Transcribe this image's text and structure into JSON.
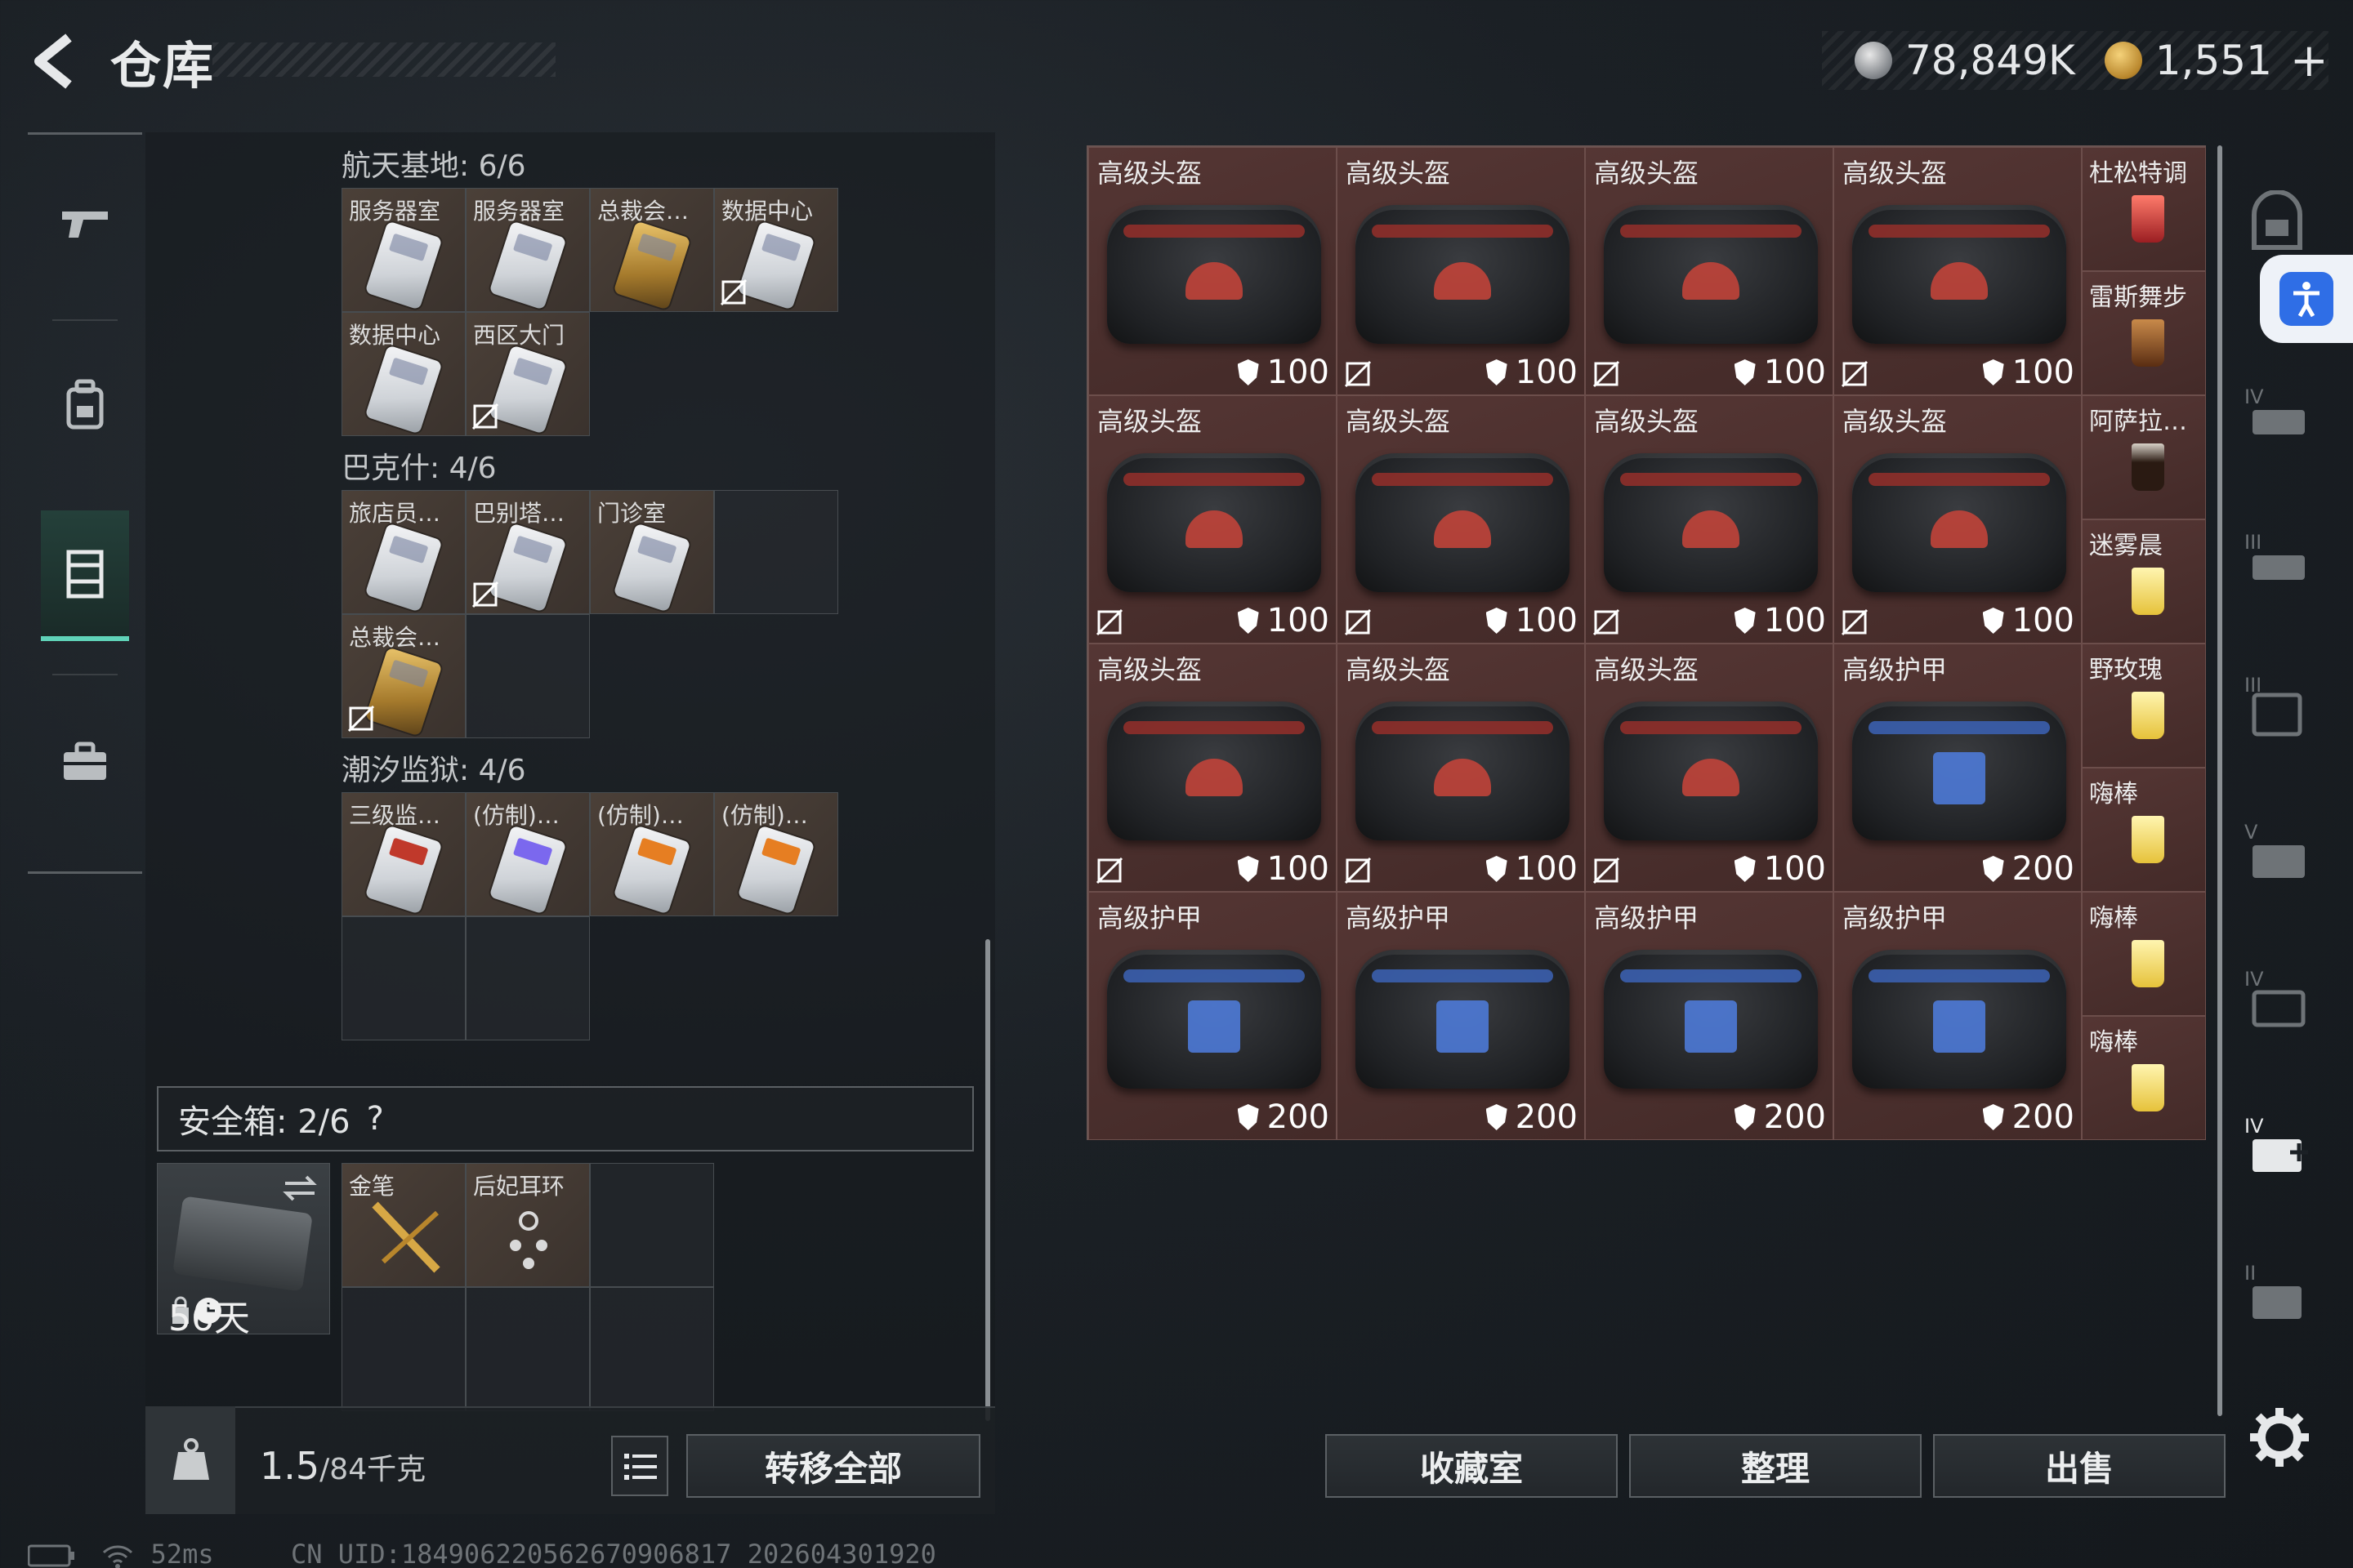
{
  "header": {
    "title": "仓库",
    "currency_silver": "78,849K",
    "currency_gold": "1,551",
    "plus": "+"
  },
  "left_nav": {
    "items": [
      "weapon-icon",
      "backpack-icon",
      "storage-icon",
      "briefcase-icon"
    ],
    "active": "storage-icon"
  },
  "sections": [
    {
      "label": "航天基地: 6/6",
      "cells": [
        {
          "label": "服务器室"
        },
        {
          "label": "服务器室"
        },
        {
          "label": "总裁会…"
        },
        {
          "label": "数据中心"
        },
        {
          "label": "数据中心"
        },
        {
          "label": "西区大门"
        }
      ]
    },
    {
      "label": "巴克什: 4/6",
      "cells": [
        {
          "label": "旅店员…"
        },
        {
          "label": "巴别塔…"
        },
        {
          "label": "门诊室"
        },
        {
          "label": "总裁会…"
        }
      ]
    },
    {
      "label": "潮汐监狱: 4/6",
      "cells": [
        {
          "label": "三级监…"
        },
        {
          "label": "(仿制)…"
        },
        {
          "label": "(仿制)…"
        },
        {
          "label": "(仿制)…"
        }
      ]
    }
  ],
  "safe_box": {
    "label": "安全箱: 2/6",
    "help": "?",
    "days": "56天",
    "items": [
      {
        "label": "金笔"
      },
      {
        "label": "后妃耳环"
      }
    ]
  },
  "bottom_left": {
    "weight": "1.5",
    "weight_max": "/84千克",
    "transfer_all": "转移全部"
  },
  "stash": {
    "rows": [
      [
        {
          "label": "高级头盔",
          "dur": "100"
        },
        {
          "label": "高级头盔",
          "dur": "100"
        },
        {
          "label": "高级头盔",
          "dur": "100"
        },
        {
          "label": "高级头盔",
          "dur": "100"
        }
      ],
      [
        {
          "label": "高级头盔",
          "dur": "100"
        },
        {
          "label": "高级头盔",
          "dur": "100"
        },
        {
          "label": "高级头盔",
          "dur": "100"
        },
        {
          "label": "高级头盔",
          "dur": "100"
        }
      ],
      [
        {
          "label": "高级头盔",
          "dur": "100"
        },
        {
          "label": "高级头盔",
          "dur": "100"
        },
        {
          "label": "高级头盔",
          "dur": "100"
        },
        {
          "label": "高级护甲",
          "dur": "200"
        }
      ],
      [
        {
          "label": "高级护甲",
          "dur": "200"
        },
        {
          "label": "高级护甲",
          "dur": "200"
        },
        {
          "label": "高级护甲",
          "dur": "200"
        },
        {
          "label": "高级护甲",
          "dur": "200"
        }
      ]
    ],
    "drinks": [
      {
        "label": "杜松特调"
      },
      {
        "label": "雷斯舞步"
      },
      {
        "label": "阿萨拉…"
      },
      {
        "label": "迷雾晨"
      },
      {
        "label": "野玫瑰"
      },
      {
        "label": "嗨棒"
      },
      {
        "label": "嗨棒"
      },
      {
        "label": "嗨棒"
      }
    ]
  },
  "buttons": {
    "collection": "收藏室",
    "sort": "整理",
    "sell": "出售"
  },
  "status": {
    "ping": "52ms",
    "uid": "CN UID:184906220562670906817_202604301920"
  }
}
